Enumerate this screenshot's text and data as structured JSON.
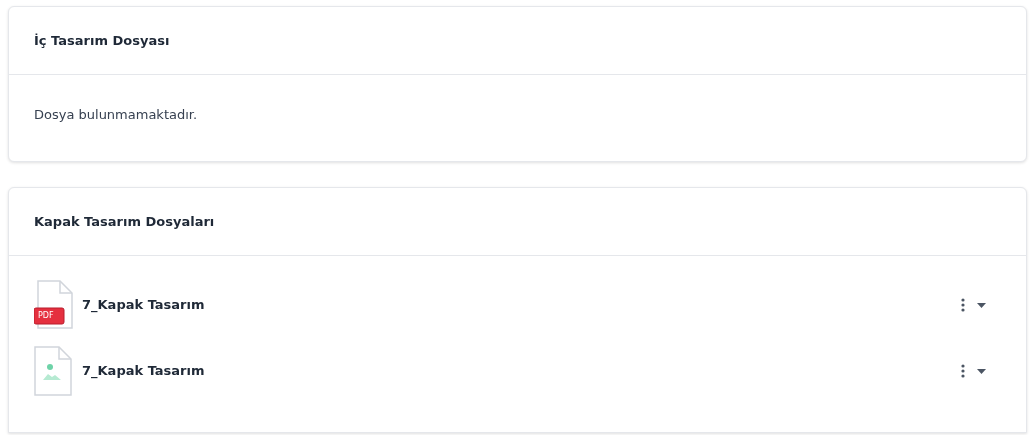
{
  "sections": [
    {
      "title": "İç Tasarım Dosyası",
      "empty_message": "Dosya bulunmamaktadır."
    },
    {
      "title": "Kapak Tasarım Dosyaları",
      "files": [
        {
          "kind": "pdf",
          "badge": "PDF",
          "name": "7_Kapak Tasarım"
        },
        {
          "kind": "image",
          "name": "7_Kapak Tasarım"
        }
      ]
    }
  ]
}
